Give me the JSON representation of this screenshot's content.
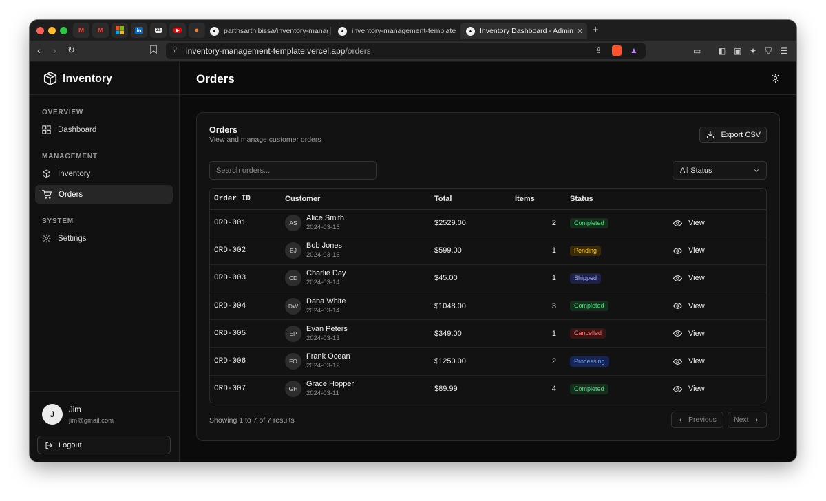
{
  "browser": {
    "pinned_tabs": [
      "gmail-icon",
      "gmail-icon",
      "microsoft-icon",
      "linkedin-icon",
      "calendar-icon",
      "youtube-icon",
      "fire-icon"
    ],
    "tabs": [
      {
        "title": "parthsarthibissa/inventory-manage",
        "icon": "github-icon"
      },
      {
        "title": "inventory-management-template",
        "icon": "vercel-icon"
      },
      {
        "title": "Inventory Dashboard - Admin",
        "icon": "vercel-icon"
      }
    ],
    "url_host": "inventory-management-template.vercel.app",
    "url_path": "/orders"
  },
  "sidebar": {
    "brand": "Inventory",
    "sections": {
      "overview": "OVERVIEW",
      "management": "MANAGEMENT",
      "system": "SYSTEM"
    },
    "items": {
      "dashboard": "Dashboard",
      "inventory": "Inventory",
      "orders": "Orders",
      "settings": "Settings"
    },
    "active": "Orders",
    "user": {
      "initial": "J",
      "name": "Jim",
      "email": "jim@gmail.com"
    },
    "logout_label": "Logout"
  },
  "header": {
    "title": "Orders"
  },
  "card": {
    "title": "Orders",
    "subtitle": "View and manage customer orders",
    "export_label": "Export CSV",
    "search_placeholder": "Search orders...",
    "status_filter": "All Status"
  },
  "table": {
    "columns": [
      "Order ID",
      "Customer",
      "Total",
      "Items",
      "Status"
    ],
    "rows": [
      {
        "id": "ORD-001",
        "initials": "AS",
        "name": "Alice Smith",
        "date": "2024-03-15",
        "total": "$2529.00",
        "items": "2",
        "status": "Completed",
        "action": "View"
      },
      {
        "id": "ORD-002",
        "initials": "BJ",
        "name": "Bob Jones",
        "date": "2024-03-15",
        "total": "$599.00",
        "items": "1",
        "status": "Pending",
        "action": "View"
      },
      {
        "id": "ORD-003",
        "initials": "CD",
        "name": "Charlie Day",
        "date": "2024-03-14",
        "total": "$45.00",
        "items": "1",
        "status": "Shipped",
        "action": "View"
      },
      {
        "id": "ORD-004",
        "initials": "DW",
        "name": "Dana White",
        "date": "2024-03-14",
        "total": "$1048.00",
        "items": "3",
        "status": "Completed",
        "action": "View"
      },
      {
        "id": "ORD-005",
        "initials": "EP",
        "name": "Evan Peters",
        "date": "2024-03-13",
        "total": "$349.00",
        "items": "1",
        "status": "Cancelled",
        "action": "View"
      },
      {
        "id": "ORD-006",
        "initials": "FO",
        "name": "Frank Ocean",
        "date": "2024-03-12",
        "total": "$1250.00",
        "items": "2",
        "status": "Processing",
        "action": "View"
      },
      {
        "id": "ORD-007",
        "initials": "GH",
        "name": "Grace Hopper",
        "date": "2024-03-11",
        "total": "$89.99",
        "items": "4",
        "status": "Completed",
        "action": "View"
      }
    ]
  },
  "status_colors": {
    "Completed": {
      "bg": "#14301c",
      "fg": "#4ade80"
    },
    "Pending": {
      "bg": "#3a2a08",
      "fg": "#facc15"
    },
    "Shipped": {
      "bg": "#1e2147",
      "fg": "#a5b4fc"
    },
    "Cancelled": {
      "bg": "#3b1414",
      "fg": "#f87171"
    },
    "Processing": {
      "bg": "#172554",
      "fg": "#60a5fa"
    }
  },
  "pagination": {
    "summary": "Showing 1 to 7 of 7 results",
    "prev_label": "Previous",
    "next_label": "Next"
  }
}
